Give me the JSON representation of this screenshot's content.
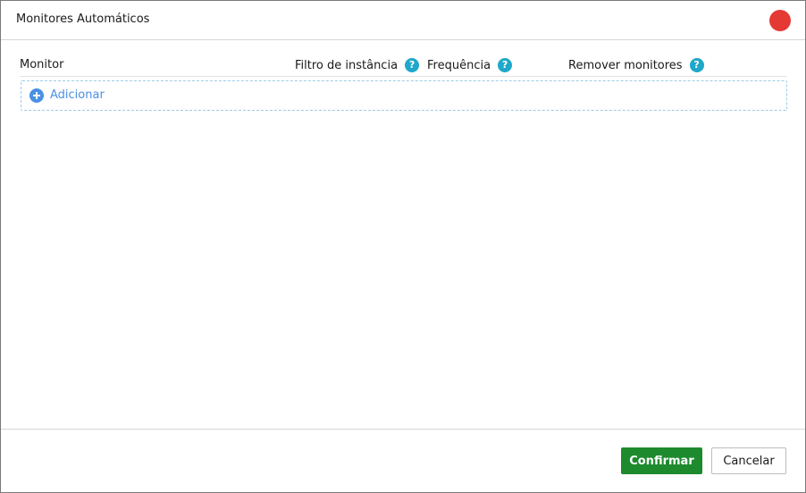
{
  "dialog": {
    "title": "Monitores Automáticos",
    "close_color": "#e53935"
  },
  "table": {
    "headers": {
      "monitor": "Monitor",
      "filter": "Filtro de instância",
      "frequency": "Frequência",
      "remove": "Remover monitores"
    },
    "help_glyph": "?",
    "add_label": "Adicionar"
  },
  "footer": {
    "confirm_label": "Confirmar",
    "cancel_label": "Cancelar",
    "confirm_color": "#1e8a2e"
  },
  "icons": {
    "close": "close-icon",
    "help": "help-icon",
    "add": "plus-circle-icon"
  }
}
